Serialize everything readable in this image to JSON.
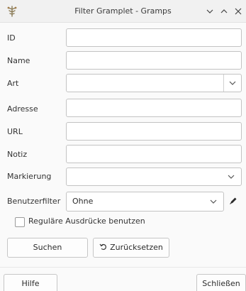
{
  "window": {
    "title": "Filter Gramplet - Gramps",
    "app_icon": "gramps-tree-icon",
    "controls": [
      "minimize-icon",
      "maximize-icon",
      "close-icon"
    ]
  },
  "form": {
    "id_label": "ID",
    "id_value": "",
    "name_label": "Name",
    "name_value": "",
    "art_label": "Art",
    "art_value": "",
    "adresse_label": "Adresse",
    "adresse_value": "",
    "url_label": "URL",
    "url_value": "",
    "notiz_label": "Notiz",
    "notiz_value": "",
    "markierung_label": "Markierung",
    "markierung_value": "",
    "benutzerfilter_label": "Benutzerfilter",
    "benutzerfilter_value": "Ohne",
    "regex_label": "Reguläre Ausdrücke benutzen",
    "regex_checked": false
  },
  "buttons": {
    "search": "Suchen",
    "reset": "Zurücksetzen",
    "help": "Hilfe",
    "close": "Schließen"
  }
}
